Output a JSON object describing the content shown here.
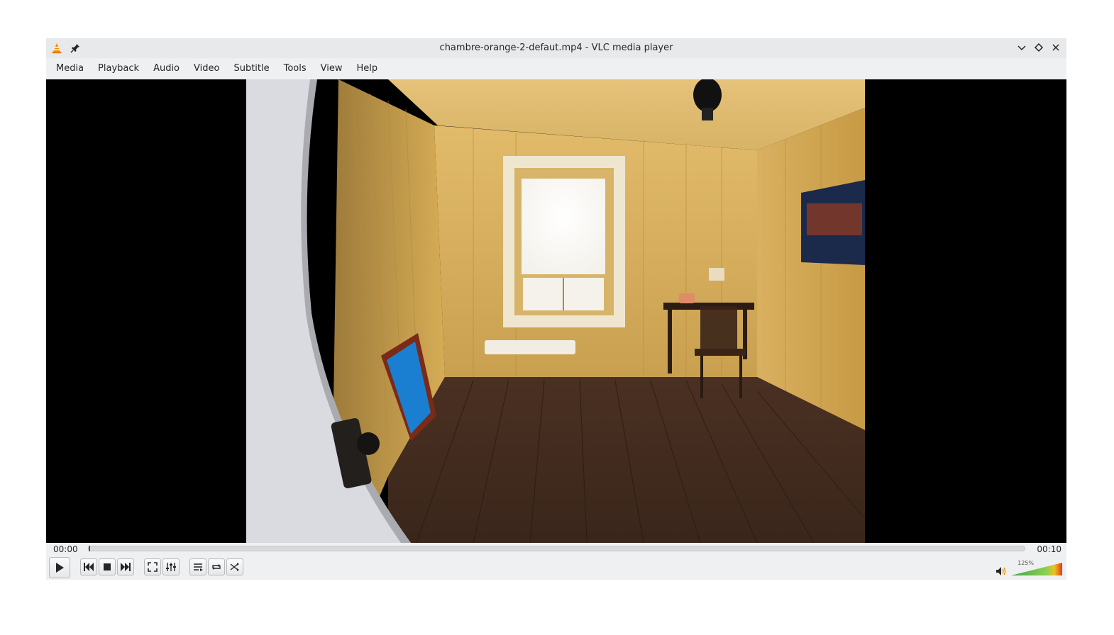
{
  "window": {
    "title": "chambre-orange-2-defaut.mp4 - VLC media player"
  },
  "titlebar_icons": {
    "app": "vlc-cone-icon",
    "pin": "pin-icon",
    "minimize": "chevron-down-icon",
    "maximize": "diamond-icon",
    "close": "close-icon"
  },
  "menu": {
    "items": [
      "Media",
      "Playback",
      "Audio",
      "Video",
      "Subtitle",
      "Tools",
      "View",
      "Help"
    ]
  },
  "playback": {
    "current_time": "00:00",
    "total_time": "00:10",
    "progress": 0.0
  },
  "controls": {
    "play": "play-icon",
    "previous": "skip-back-icon",
    "stop": "stop-icon",
    "next": "skip-forward-icon",
    "fullscreen": "fullscreen-icon",
    "extended": "equalizer-icon",
    "playlist": "playlist-icon",
    "loop": "loop-icon",
    "shuffle": "shuffle-icon"
  },
  "volume": {
    "label": "125%",
    "level": 1.0
  },
  "colors": {
    "accent": "#3daee9",
    "vlc_orange": "#f08a00"
  }
}
